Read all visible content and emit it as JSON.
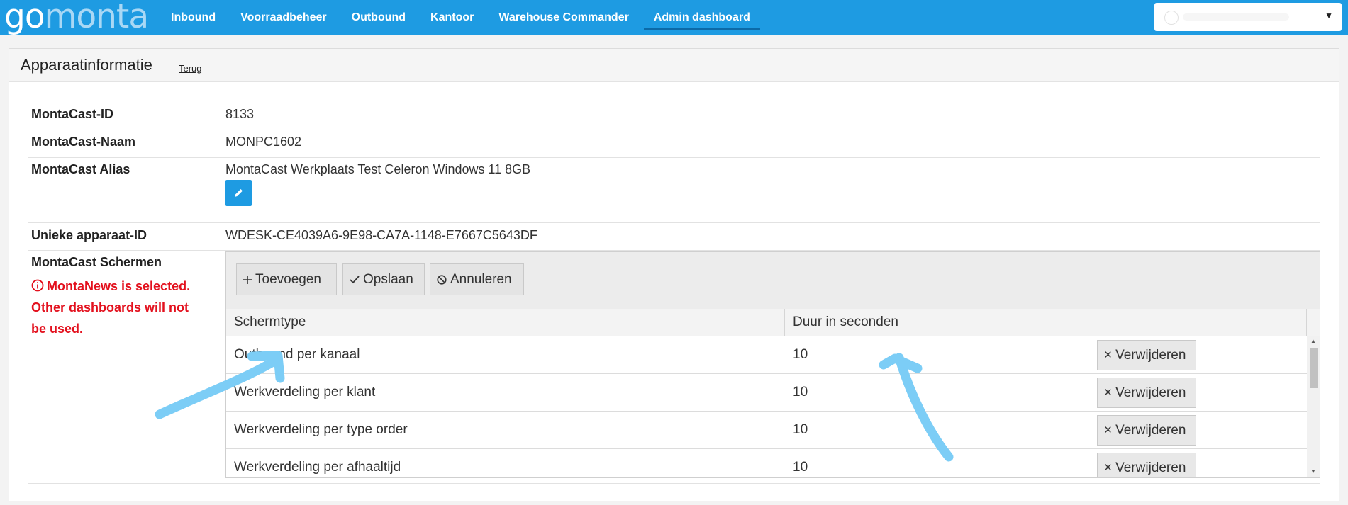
{
  "header": {
    "logo_go": "go",
    "logo_monta": "monta",
    "nav": [
      {
        "label": "Inbound"
      },
      {
        "label": "Voorraadbeheer"
      },
      {
        "label": "Outbound"
      },
      {
        "label": "Kantoor"
      },
      {
        "label": "Warehouse Commander"
      },
      {
        "label": "Admin dashboard",
        "active": true
      }
    ]
  },
  "panel": {
    "title": "Apparaatinformatie",
    "back_link": "Terug"
  },
  "fields": {
    "id_label": "MontaCast-ID",
    "id_value": "8133",
    "name_label": "MontaCast-Naam",
    "name_value": "MONPC1602",
    "alias_label": "MontaCast Alias",
    "alias_value": "MontaCast Werkplaats Test Celeron Windows 11 8GB",
    "device_label": "Unieke apparaat-ID",
    "device_value": "WDESK-CE4039A6-9E98-CA7A-1148-E7667C5643DF",
    "screens_label": "MontaCast Schermen",
    "screens_warning": "MontaNews is selected. Other dashboards will not be used."
  },
  "screens": {
    "add_label": "Toevoegen",
    "save_label": "Opslaan",
    "cancel_label": "Annuleren",
    "columns": [
      "Schermtype",
      "Duur in seconden"
    ],
    "delete_label": "Verwijderen",
    "rows": [
      {
        "type": "Outbound per kanaal",
        "duration": "10"
      },
      {
        "type": "Werkverdeling per klant",
        "duration": "10"
      },
      {
        "type": "Werkverdeling per type order",
        "duration": "10"
      },
      {
        "type": "Werkverdeling per afhaaltijd",
        "duration": "10"
      }
    ]
  },
  "colors": {
    "topbar": "#1e9be2",
    "warning": "#e3111e",
    "annotation_arrow": "#7ccdf6"
  },
  "icons": [
    "pencil-icon",
    "info-circle-icon",
    "plus-icon",
    "check-icon",
    "ban-icon",
    "times-icon",
    "chevron-down-icon"
  ]
}
